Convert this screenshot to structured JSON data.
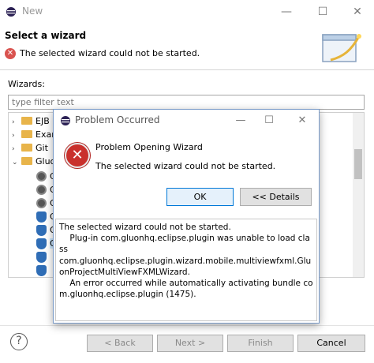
{
  "window": {
    "title": "New",
    "minimize": "—",
    "maximize": "☐",
    "close": "✕"
  },
  "header": {
    "title": "Select a wizard",
    "error_message": "The selected wizard could not be started.",
    "error_icon": "error-circle-icon"
  },
  "wizards": {
    "label": "Wizards:",
    "filter_placeholder": "type filter text",
    "tree": [
      {
        "label": "EJB",
        "expanded": false
      },
      {
        "label": "Exar",
        "expanded": false
      },
      {
        "label": "Git",
        "expanded": false
      },
      {
        "label": "Gluo",
        "expanded": true
      }
    ],
    "child_prefix": "G"
  },
  "buttons": {
    "back": "< Back",
    "next": "Next >",
    "finish": "Finish",
    "cancel": "Cancel",
    "help": "?"
  },
  "dialog": {
    "title": "Problem Occurred",
    "heading": "Problem Opening Wizard",
    "message": "The selected wizard could not be started.",
    "ok": "OK",
    "details_toggle": "<< Details",
    "details_text": "The selected wizard could not be started.\n    Plug-in com.gluonhq.eclipse.plugin was unable to load class\ncom.gluonhq.eclipse.plugin.wizard.mobile.multiviewfxml.GluonProjectMultiViewFXMLWizard.\n    An error occurred while automatically activating bundle com.gluonhq.eclipse.plugin (1475)."
  },
  "colors": {
    "error": "#c9302c",
    "default_button_border": "#0078d7",
    "folder": "#e8b44a",
    "gluon_blue": "#2f6db6"
  }
}
